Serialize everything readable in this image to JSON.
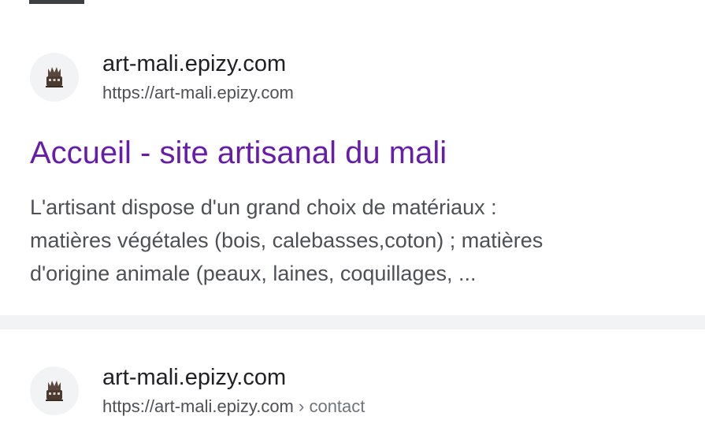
{
  "results": [
    {
      "site_name": "art-mali.epizy.com",
      "url": "https://art-mali.epizy.com",
      "breadcrumb": "",
      "favicon": "mask-sculpture-icon",
      "title": "Accueil - site artisanal du mali",
      "snippet_lines": [
        "L'artisant dispose d'un grand choix de matériaux :",
        "matières végétales (bois, calebasses,coton) ; matières",
        "d'origine animale (peaux, laines, coquillages, ..."
      ]
    },
    {
      "site_name": "art-mali.epizy.com",
      "url": "https://art-mali.epizy.com",
      "breadcrumb": "› contact",
      "favicon": "mask-sculpture-icon"
    }
  ],
  "colors": {
    "visited_link": "#681da8",
    "snippet": "#4d5156",
    "site_name": "#202124",
    "divider": "#f1f3f4"
  }
}
